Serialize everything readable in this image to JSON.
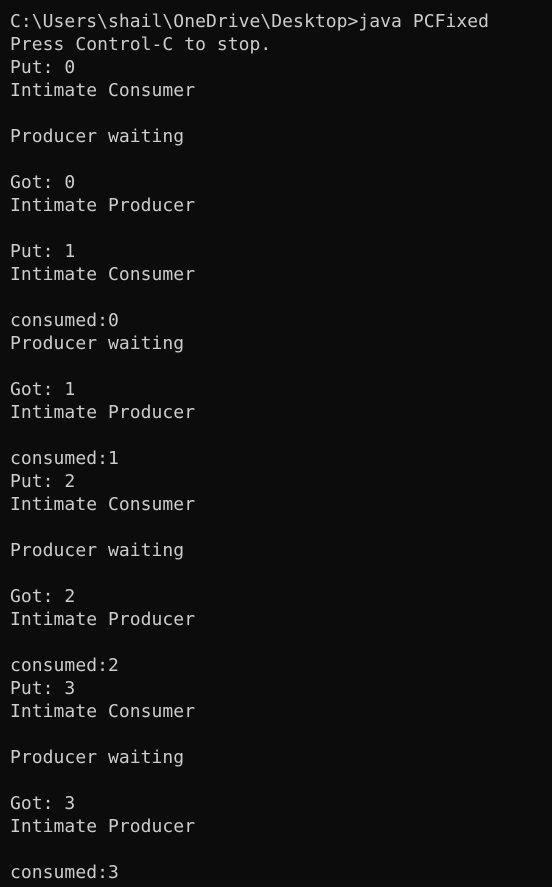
{
  "terminal": {
    "background": "#0c0c0c",
    "foreground": "#cccccc",
    "lines": [
      "C:\\Users\\shail\\OneDrive\\Desktop>java PCFixed",
      "Press Control-C to stop.",
      "Put: 0",
      "Intimate Consumer",
      "",
      "Producer waiting",
      "",
      "Got: 0",
      "Intimate Producer",
      "",
      "Put: 1",
      "Intimate Consumer",
      "",
      "consumed:0",
      "Producer waiting",
      "",
      "Got: 1",
      "Intimate Producer",
      "",
      "consumed:1",
      "Put: 2",
      "Intimate Consumer",
      "",
      "Producer waiting",
      "",
      "Got: 2",
      "Intimate Producer",
      "",
      "consumed:2",
      "Put: 3",
      "Intimate Consumer",
      "",
      "Producer waiting",
      "",
      "Got: 3",
      "Intimate Producer",
      "",
      "consumed:3"
    ]
  }
}
